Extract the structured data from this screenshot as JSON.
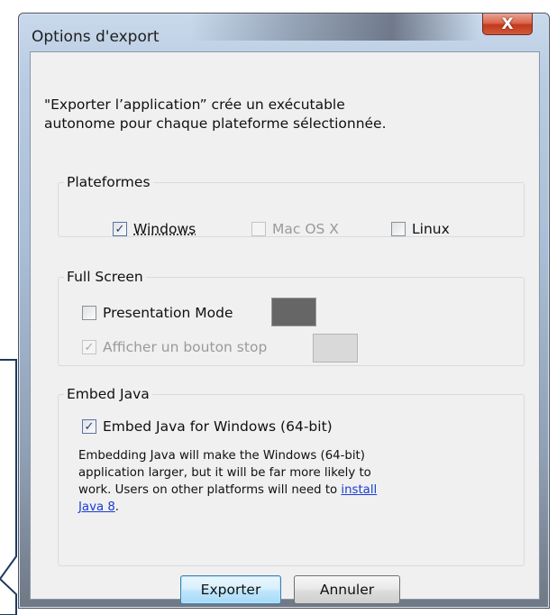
{
  "window": {
    "title": "Options d'export",
    "close_label": "X"
  },
  "intro": {
    "line1": "\"Exporter l’application” crée un exécutable",
    "line2": "autonome pour chaque plateforme sélectionnée."
  },
  "platforms": {
    "legend": "Plateformes",
    "windows": {
      "label": "Windows",
      "checked": true
    },
    "macos": {
      "label": "Mac OS X",
      "checked": false,
      "disabled": true
    },
    "linux": {
      "label": "Linux",
      "checked": false
    }
  },
  "fullscreen": {
    "legend": "Full Screen",
    "presentation": {
      "label": "Presentation Mode",
      "checked": false,
      "swatch_color": "#666666"
    },
    "stop_button": {
      "label": "Afficher un bouton stop",
      "checked": true,
      "disabled": true,
      "swatch_color": "#d9d9d9"
    }
  },
  "java": {
    "legend": "Embed Java",
    "embed": {
      "label": "Embed Java for Windows (64-bit)",
      "checked": true
    },
    "desc_line1": "Embedding Java will make the Windows (64-bit)",
    "desc_line2": "application larger, but it will be far more likely to",
    "desc_line3": "work. Users on other platforms will need to ",
    "link_part1": "install",
    "link_part2": "Java 8",
    "desc_end": "."
  },
  "buttons": {
    "export": "Exporter",
    "cancel": "Annuler"
  },
  "checkmark": "✓"
}
